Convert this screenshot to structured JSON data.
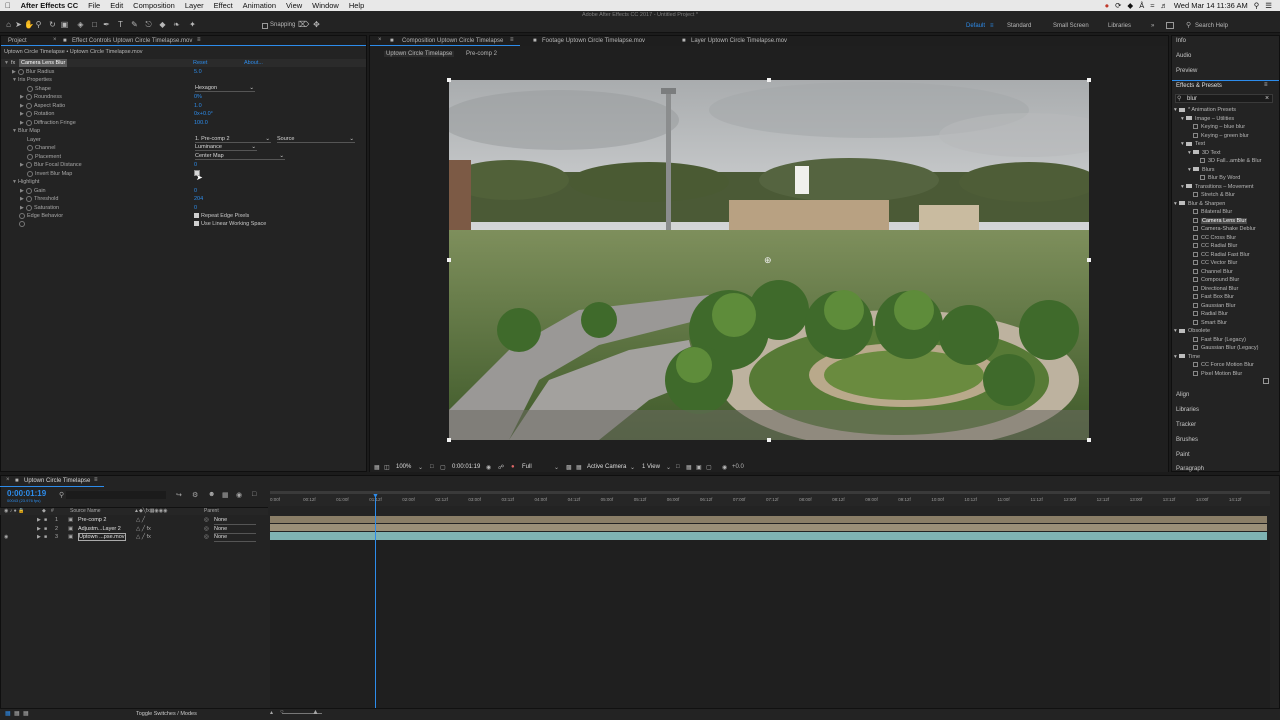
{
  "menubar": {
    "app_name": "After Effects CC",
    "items": [
      "File",
      "Edit",
      "Composition",
      "Layer",
      "Effect",
      "Animation",
      "View",
      "Window",
      "Help"
    ],
    "clock": "Wed Mar 14  11:36 AM"
  },
  "window_title": "Adobe After Effects CC 2017 - Untitled Project *",
  "toolbar": {
    "snapping_label": "Snapping",
    "workspaces": [
      "Default",
      "Standard",
      "Small Screen",
      "Libraries"
    ],
    "search_placeholder": "Search Help"
  },
  "effect_controls": {
    "tab_project": "Project",
    "tab_label": "Effect Controls",
    "tab_target": "Uptown Circle Timelapse.mov",
    "breadcrumb": "Uptown Circle Timelapse • Uptown Circle Timelapse.mov",
    "effect_name": "Camera Lens Blur",
    "reset": "Reset",
    "about": "About...",
    "rows": [
      {
        "label": "Blur Radius",
        "value": "5.0",
        "indent": 1
      },
      {
        "label": "Iris Properties",
        "value": "",
        "indent": 0
      },
      {
        "label": "Shape",
        "value": "",
        "indent": 2
      },
      {
        "label": "Roundness",
        "value": "0%",
        "indent": 2
      },
      {
        "label": "Aspect Ratio",
        "value": "1.0",
        "indent": 2
      },
      {
        "label": "Rotation",
        "value": "0x+0.0°",
        "indent": 2
      },
      {
        "label": "Diffraction Fringe",
        "value": "100.0",
        "indent": 2
      },
      {
        "label": "Blur Map",
        "value": "",
        "indent": 0
      },
      {
        "label": "Layer",
        "value": "",
        "indent": 2
      },
      {
        "label": "Channel",
        "value": "",
        "indent": 2
      },
      {
        "label": "Placement",
        "value": "",
        "indent": 2
      },
      {
        "label": "Blur Focal Distance",
        "value": "0",
        "indent": 2
      },
      {
        "label": "Invert Blur Map",
        "value": "",
        "indent": 2
      },
      {
        "label": "Highlight",
        "value": "",
        "indent": 0
      },
      {
        "label": "Gain",
        "value": "0",
        "indent": 2
      },
      {
        "label": "Threshold",
        "value": "204",
        "indent": 2
      },
      {
        "label": "Saturation",
        "value": "0",
        "indent": 2
      },
      {
        "label": "Edge Behavior",
        "value": "",
        "indent": 1
      }
    ],
    "shape_value": "Hexagon",
    "layer_value": "1. Pre-comp 2",
    "layer_source": "Source",
    "channel_value": "Luminance",
    "placement_value": "Center Map",
    "repeat_edge": "Repeat Edge Pixels",
    "linear_space": "Use Linear Working Space"
  },
  "composition": {
    "tab_comp": "Composition",
    "tab_comp_name": "Uptown Circle Timelapse",
    "tab_footage": "Footage Uptown Circle Timelapse.mov",
    "tab_layer": "Layer Uptown Circle Timelapse.mov",
    "sub_tabs": [
      "Uptown Circle Timelapse",
      "Pre-comp 2"
    ],
    "zoom": "100%",
    "timecode": "0:00:01:19",
    "resolution": "Full",
    "camera": "Active Camera",
    "views": "1 View",
    "exposure": "+0.0"
  },
  "right_panels": {
    "top": [
      "Info",
      "Audio",
      "Preview"
    ],
    "effects_title": "Effects & Presets",
    "search_value": "blur",
    "tree": [
      {
        "label": "* Animation Presets",
        "level": 0,
        "kind": "folder"
      },
      {
        "label": "Image – Utilities",
        "level": 1,
        "kind": "folder"
      },
      {
        "label": "Keying – blue blur",
        "level": 2,
        "kind": "fx"
      },
      {
        "label": "Keying – green blur",
        "level": 2,
        "kind": "fx"
      },
      {
        "label": "Text",
        "level": 1,
        "kind": "folder"
      },
      {
        "label": "3D Text",
        "level": 2,
        "kind": "folder"
      },
      {
        "label": "3D Fall...amble & Blur",
        "level": 3,
        "kind": "fx"
      },
      {
        "label": "Blurs",
        "level": 2,
        "kind": "folder"
      },
      {
        "label": "Blur By Word",
        "level": 3,
        "kind": "fx"
      },
      {
        "label": "Transitions – Movement",
        "level": 1,
        "kind": "folder"
      },
      {
        "label": "Stretch & Blur",
        "level": 2,
        "kind": "fx"
      },
      {
        "label": "Blur & Sharpen",
        "level": 0,
        "kind": "folder"
      },
      {
        "label": "Bilateral Blur",
        "level": 2,
        "kind": "fx"
      },
      {
        "label": "Camera Lens Blur",
        "level": 2,
        "kind": "fx",
        "selected": true
      },
      {
        "label": "Camera-Shake Deblur",
        "level": 2,
        "kind": "fx"
      },
      {
        "label": "CC Cross Blur",
        "level": 2,
        "kind": "fx"
      },
      {
        "label": "CC Radial Blur",
        "level": 2,
        "kind": "fx"
      },
      {
        "label": "CC Radial Fast Blur",
        "level": 2,
        "kind": "fx"
      },
      {
        "label": "CC Vector Blur",
        "level": 2,
        "kind": "fx"
      },
      {
        "label": "Channel Blur",
        "level": 2,
        "kind": "fx"
      },
      {
        "label": "Compound Blur",
        "level": 2,
        "kind": "fx"
      },
      {
        "label": "Directional Blur",
        "level": 2,
        "kind": "fx"
      },
      {
        "label": "Fast Box Blur",
        "level": 2,
        "kind": "fx"
      },
      {
        "label": "Gaussian Blur",
        "level": 2,
        "kind": "fx"
      },
      {
        "label": "Radial Blur",
        "level": 2,
        "kind": "fx"
      },
      {
        "label": "Smart Blur",
        "level": 2,
        "kind": "fx"
      },
      {
        "label": "Obsolete",
        "level": 0,
        "kind": "folder"
      },
      {
        "label": "Fast Blur (Legacy)",
        "level": 2,
        "kind": "fx"
      },
      {
        "label": "Gaussian Blur (Legacy)",
        "level": 2,
        "kind": "fx"
      },
      {
        "label": "Time",
        "level": 0,
        "kind": "folder"
      },
      {
        "label": "CC Force Motion Blur",
        "level": 2,
        "kind": "fx"
      },
      {
        "label": "Pixel Motion Blur",
        "level": 2,
        "kind": "fx"
      }
    ],
    "bottom": [
      "Align",
      "Libraries",
      "Tracker",
      "Brushes",
      "Paint",
      "Paragraph"
    ]
  },
  "timeline": {
    "tab": "Uptown Circle Timelapse",
    "timecode": "0:00:01:19",
    "frame_info": "00043 (23.976 fps)",
    "col_source": "Source Name",
    "col_parent": "Parent",
    "layers": [
      {
        "num": "1",
        "name": "Pre-comp 2",
        "parent": "None"
      },
      {
        "num": "2",
        "name": "Adjustm...Layer 2",
        "parent": "None"
      },
      {
        "num": "3",
        "name": "Uptown ...pse.mov",
        "parent": "None"
      }
    ],
    "ruler": [
      "0:00f",
      "00:12f",
      "01:00f",
      "01:12f",
      "02:00f",
      "02:12f",
      "03:00f",
      "03:12f",
      "04:00f",
      "04:12f",
      "05:00f",
      "05:12f",
      "06:00f",
      "06:12f",
      "07:00f",
      "07:12f",
      "08:00f",
      "08:12f",
      "09:00f",
      "09:12f",
      "10:00f",
      "10:12f",
      "11:00f",
      "11:12f",
      "12:00f",
      "12:12f",
      "13:00f",
      "13:12f",
      "14:00f",
      "14:12f"
    ],
    "toggle_label": "Toggle Switches / Modes"
  }
}
